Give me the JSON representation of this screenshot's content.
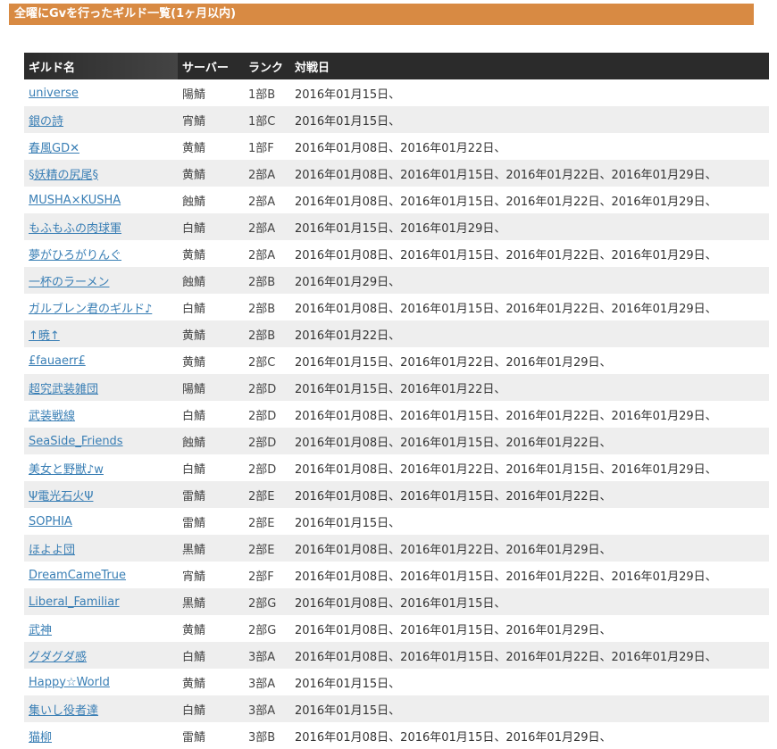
{
  "heading": "全曜にGvを行ったギルド一覧(1ヶ月以内)",
  "table": {
    "headers": {
      "name": "ギルド名",
      "server": "サーバー",
      "rank": "ランク",
      "dates": "対戦日"
    },
    "rows": [
      {
        "name": "universe",
        "server": "陽鯖",
        "rank": "1部B",
        "dates": "2016年01月15日、"
      },
      {
        "name": "銀の詩",
        "server": "宵鯖",
        "rank": "1部C",
        "dates": "2016年01月15日、"
      },
      {
        "name": "春風GD✕",
        "server": "黄鯖",
        "rank": "1部F",
        "dates": "2016年01月08日、2016年01月22日、"
      },
      {
        "name": "§妖精の尻尾§",
        "server": "黄鯖",
        "rank": "2部A",
        "dates": "2016年01月08日、2016年01月15日、2016年01月22日、2016年01月29日、"
      },
      {
        "name": "MUSHA×KUSHA",
        "server": "蝕鯖",
        "rank": "2部A",
        "dates": "2016年01月08日、2016年01月15日、2016年01月22日、2016年01月29日、"
      },
      {
        "name": "もふもふの肉球軍",
        "server": "白鯖",
        "rank": "2部A",
        "dates": "2016年01月15日、2016年01月29日、"
      },
      {
        "name": "夢がひろがりんぐ",
        "server": "黄鯖",
        "rank": "2部A",
        "dates": "2016年01月08日、2016年01月15日、2016年01月22日、2016年01月29日、"
      },
      {
        "name": "一杯のラーメン",
        "server": "蝕鯖",
        "rank": "2部B",
        "dates": "2016年01月29日、"
      },
      {
        "name": "ガルブレン君のギルド♪",
        "server": "白鯖",
        "rank": "2部B",
        "dates": "2016年01月08日、2016年01月15日、2016年01月22日、2016年01月29日、"
      },
      {
        "name": "↑暁↑",
        "server": "黄鯖",
        "rank": "2部B",
        "dates": "2016年01月22日、"
      },
      {
        "name": "£fauaerr£",
        "server": "黄鯖",
        "rank": "2部C",
        "dates": "2016年01月15日、2016年01月22日、2016年01月29日、"
      },
      {
        "name": "超究武装雑団",
        "server": "陽鯖",
        "rank": "2部D",
        "dates": "2016年01月15日、2016年01月22日、"
      },
      {
        "name": "武装戦線",
        "server": "白鯖",
        "rank": "2部D",
        "dates": "2016年01月08日、2016年01月15日、2016年01月22日、2016年01月29日、"
      },
      {
        "name": "SeaSide_Friends",
        "server": "蝕鯖",
        "rank": "2部D",
        "dates": "2016年01月08日、2016年01月15日、2016年01月22日、"
      },
      {
        "name": "美女と野獣♪w",
        "server": "白鯖",
        "rank": "2部D",
        "dates": "2016年01月08日、2016年01月22日、2016年01月15日、2016年01月29日、"
      },
      {
        "name": "Ψ電光石火Ψ",
        "server": "雷鯖",
        "rank": "2部E",
        "dates": "2016年01月08日、2016年01月15日、2016年01月22日、"
      },
      {
        "name": "SOPHIA",
        "server": "雷鯖",
        "rank": "2部E",
        "dates": "2016年01月15日、"
      },
      {
        "name": "ほよよ団",
        "server": "黒鯖",
        "rank": "2部E",
        "dates": "2016年01月08日、2016年01月22日、2016年01月29日、"
      },
      {
        "name": "DreamCameTrue",
        "server": "宵鯖",
        "rank": "2部F",
        "dates": "2016年01月08日、2016年01月15日、2016年01月22日、2016年01月29日、"
      },
      {
        "name": "Liberal_Familiar",
        "server": "黒鯖",
        "rank": "2部G",
        "dates": "2016年01月08日、2016年01月15日、"
      },
      {
        "name": "武神",
        "server": "黄鯖",
        "rank": "2部G",
        "dates": "2016年01月08日、2016年01月15日、2016年01月29日、"
      },
      {
        "name": "グダグダ感",
        "server": "白鯖",
        "rank": "3部A",
        "dates": "2016年01月08日、2016年01月15日、2016年01月22日、2016年01月29日、"
      },
      {
        "name": "Happy☆World",
        "server": "黄鯖",
        "rank": "3部A",
        "dates": "2016年01月15日、"
      },
      {
        "name": "集いし役者達",
        "server": "白鯖",
        "rank": "3部A",
        "dates": "2016年01月15日、"
      },
      {
        "name": "猫柳",
        "server": "雷鯖",
        "rank": "3部B",
        "dates": "2016年01月08日、2016年01月15日、2016年01月29日、"
      }
    ]
  }
}
